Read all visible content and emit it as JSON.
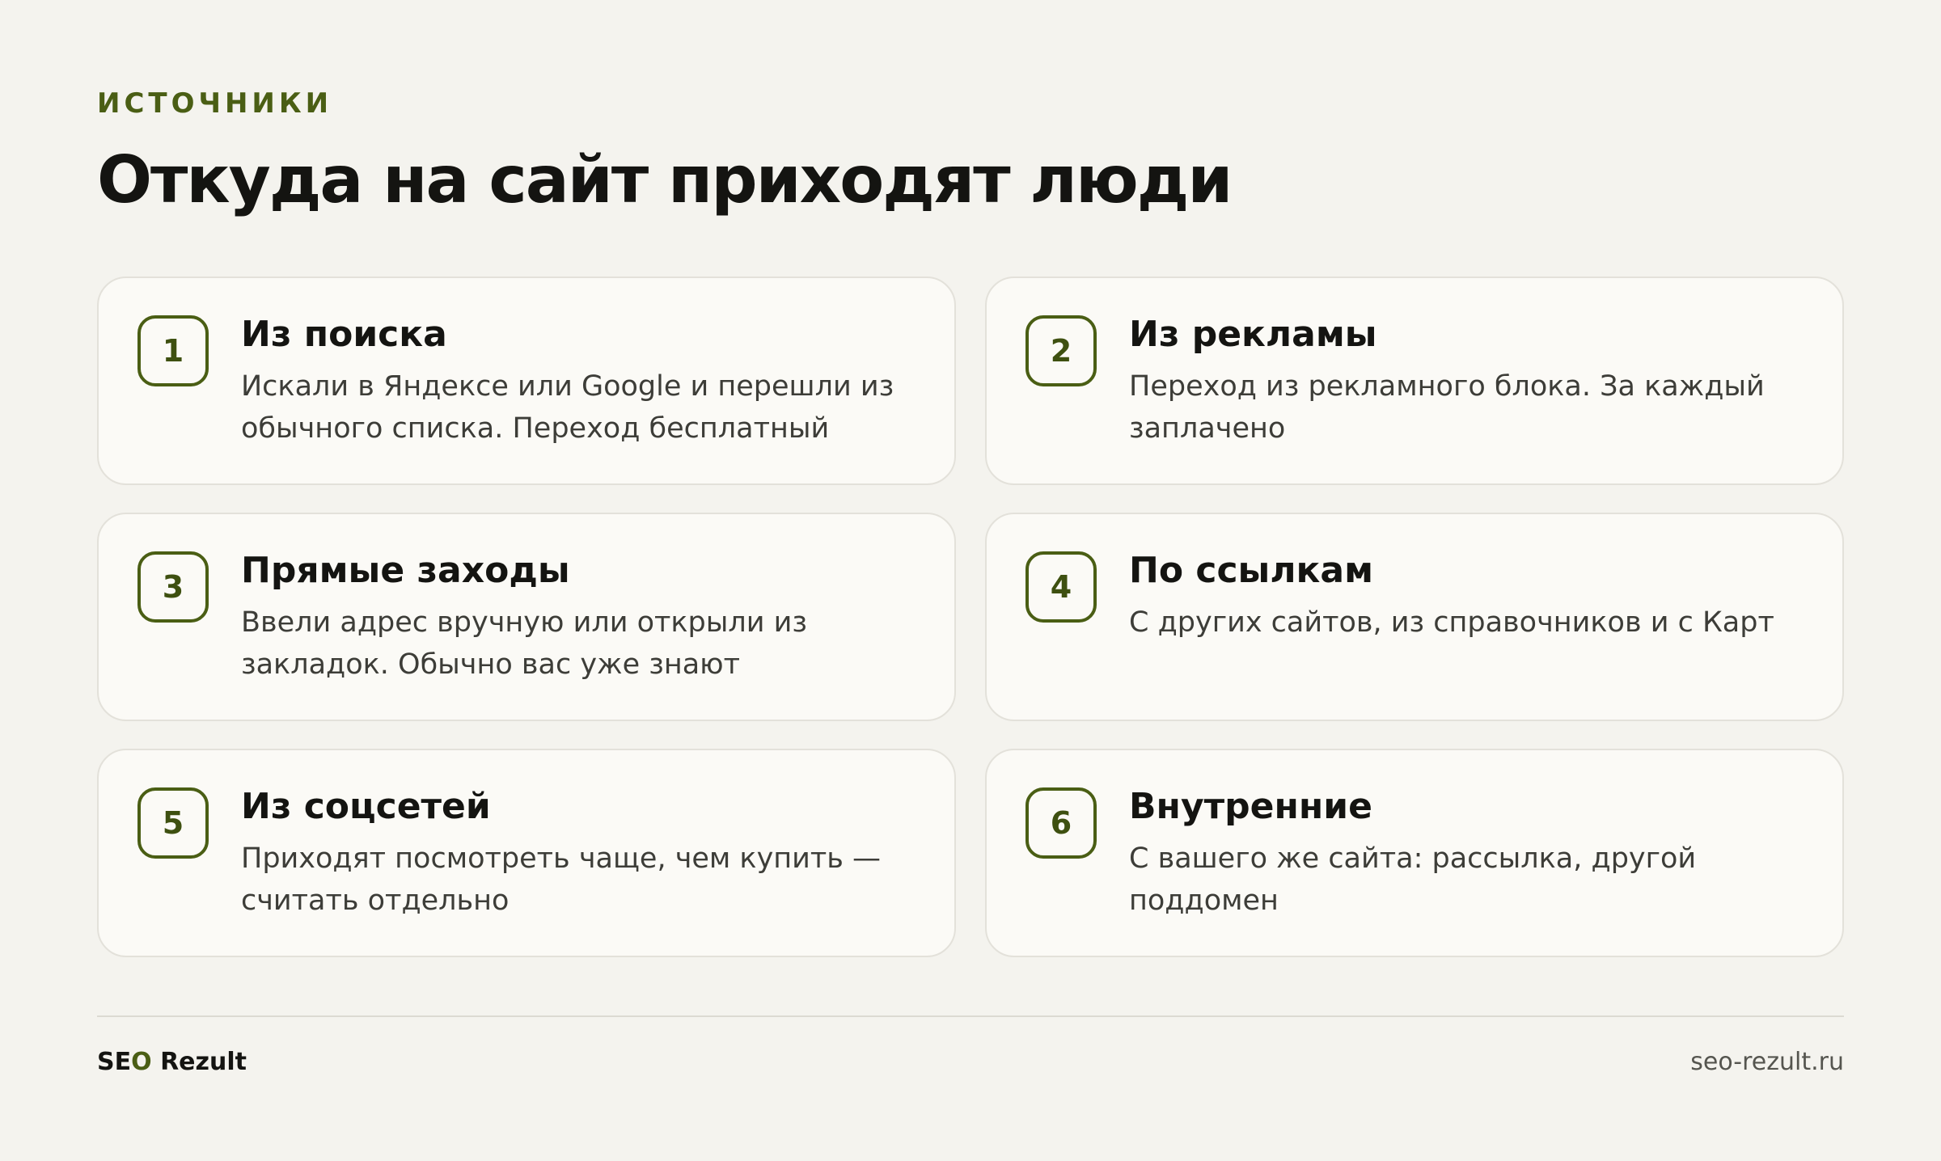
{
  "header": {
    "eyebrow": "ИСТОЧНИКИ",
    "title": "Откуда на сайт приходят люди"
  },
  "cards": [
    {
      "number": "1",
      "title": "Из поиска",
      "text": "Искали в Яндексе или Google и перешли из обычного списка. Переход бесплатный"
    },
    {
      "number": "2",
      "title": "Из рекламы",
      "text": "Переход из рекламного блока. За каждый заплачено"
    },
    {
      "number": "3",
      "title": "Прямые заходы",
      "text": "Ввели адрес вручную или открыли из закладок. Обычно вас уже знают"
    },
    {
      "number": "4",
      "title": "По ссылкам",
      "text": "С других сайтов, из справочников и с Карт"
    },
    {
      "number": "5",
      "title": "Из соцсетей",
      "text": "Приходят посмотреть чаще, чем купить — считать отдельно"
    },
    {
      "number": "6",
      "title": "Внутренние",
      "text": "С вашего же сайта: рассылка, другой поддомен"
    }
  ],
  "footer": {
    "brand_pre": "SE",
    "brand_accent": "O",
    "brand_post": " Rezult",
    "site": "seo-rezult.ru"
  },
  "colors": {
    "background": "#f4f3ee",
    "accent": "#4a5e14",
    "card": "#fbfaf6",
    "text": "#141411"
  }
}
